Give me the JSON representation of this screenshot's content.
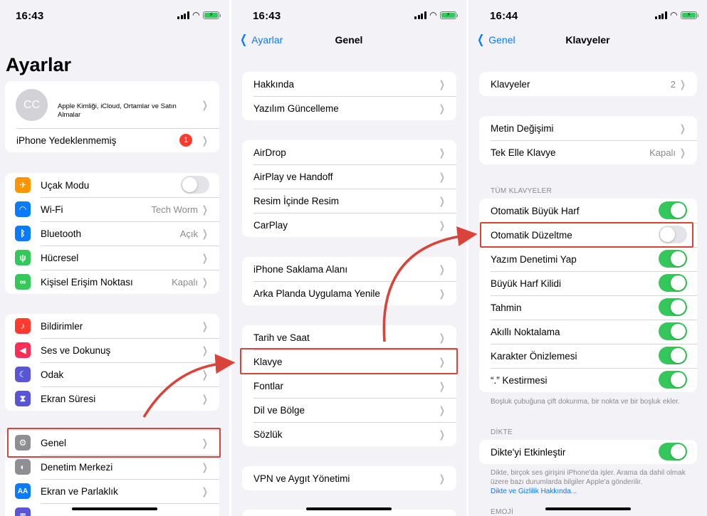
{
  "colors": {
    "accent": "#0a7aff",
    "toggle_on": "#34c759",
    "highlight": "#d9433a",
    "badge": "#ff3b30"
  },
  "panel1": {
    "time": "16:43",
    "title": "Ayarlar",
    "profile": {
      "initials": "CC",
      "text": "Apple Kimliği, iCloud, Ortamlar ve Satın Almalar"
    },
    "backup": {
      "label": "iPhone Yedeklenmemiş",
      "badge": "1"
    },
    "connectivity": [
      {
        "label": "Uçak Modu",
        "icon": "airplane-icon",
        "color": "#ff9500",
        "glyph": "✈"
      },
      {
        "label": "Wi-Fi",
        "value": "Tech Worm",
        "icon": "wifi-icon",
        "color": "#0a7aff",
        "glyph": "◠"
      },
      {
        "label": "Bluetooth",
        "value": "Açık",
        "icon": "bluetooth-icon",
        "color": "#0a7aff",
        "glyph": "ᛒ"
      },
      {
        "label": "Hücresel",
        "icon": "antenna-icon",
        "color": "#34c759",
        "glyph": "ψ"
      },
      {
        "label": "Kişisel Erişim Noktası",
        "value": "Kapalı",
        "icon": "link-icon",
        "color": "#34c759",
        "glyph": "∞"
      }
    ],
    "notifications": [
      {
        "label": "Bildirimler",
        "icon": "bell-icon",
        "color": "#ff3b30",
        "glyph": "♪"
      },
      {
        "label": "Ses ve Dokunuş",
        "icon": "speaker-icon",
        "color": "#ff2d55",
        "glyph": "◀"
      },
      {
        "label": "Odak",
        "icon": "moon-icon",
        "color": "#5856d6",
        "glyph": "☾"
      },
      {
        "label": "Ekran Süresi",
        "icon": "hourglass-icon",
        "color": "#5856d6",
        "glyph": "⧗"
      }
    ],
    "general": [
      {
        "label": "Genel",
        "icon": "gear-icon",
        "color": "#8e8e93",
        "glyph": "⚙"
      },
      {
        "label": "Denetim Merkezi",
        "icon": "switches-icon",
        "color": "#8e8e93",
        "glyph": "◐"
      },
      {
        "label": "Ekran ve Parlaklık",
        "icon": "text-size-icon",
        "color": "#0a7aff",
        "glyph": "AA"
      }
    ]
  },
  "panel2": {
    "time": "16:43",
    "back": "Ayarlar",
    "title": "Genel",
    "groups": [
      [
        "Hakkında",
        "Yazılım Güncelleme"
      ],
      [
        "AirDrop",
        "AirPlay ve Handoff",
        "Resim İçinde Resim",
        "CarPlay"
      ],
      [
        "iPhone Saklama Alanı",
        "Arka Planda Uygulama Yenile"
      ],
      [
        "Tarih ve Saat",
        "Klavye",
        "Fontlar",
        "Dil ve Bölge",
        "Sözlük"
      ],
      [
        "VPN ve Aygıt Yönetimi"
      ]
    ]
  },
  "panel3": {
    "time": "16:44",
    "back": "Genel",
    "title": "Klavyeler",
    "keyboards": {
      "label": "Klavyeler",
      "value": "2"
    },
    "text": [
      {
        "label": "Metin Değişimi"
      },
      {
        "label": "Tek Elle Klavye",
        "value": "Kapalı"
      }
    ],
    "all_keyboards_header": "TÜM KLAVYELER",
    "toggles": [
      {
        "label": "Otomatik Büyük Harf",
        "on": true
      },
      {
        "label": "Otomatik Düzeltme",
        "on": false
      },
      {
        "label": "Yazım Denetimi Yap",
        "on": true
      },
      {
        "label": "Büyük Harf Kilidi",
        "on": true
      },
      {
        "label": "Tahmin",
        "on": true
      },
      {
        "label": "Akıllı Noktalama",
        "on": true
      },
      {
        "label": "Karakter Önizlemesi",
        "on": true
      },
      {
        "label": "“.” Kestirmesi",
        "on": true
      }
    ],
    "shortcut_note": "Boşluk çubuğuna çift dokunma, bir nokta ve bir boşluk ekler.",
    "dictation_header": "DİKTE",
    "dictation": {
      "label": "Dikte'yi Etkinleştir",
      "on": true
    },
    "dictation_note": "Dikte, birçok ses girişini iPhone'da işler. Arama da dahil olmak üzere bazı durumlarda bilgiler Apple'a gönderilir.",
    "dictation_link": "Dikte ve Gizlilik Hakkında...",
    "emoji_header": "EMOJİ"
  }
}
